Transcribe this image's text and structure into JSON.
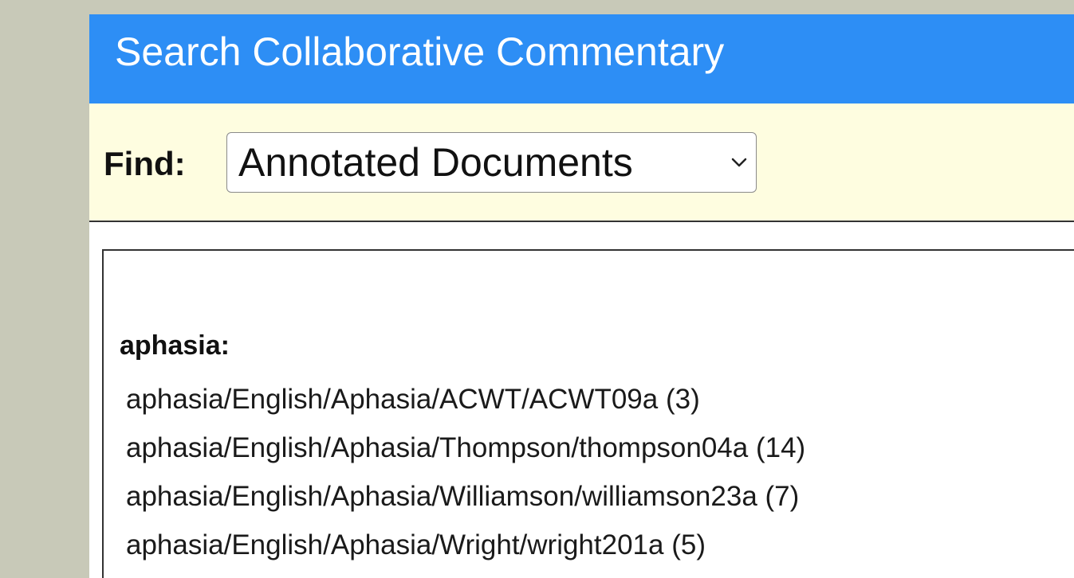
{
  "header": {
    "title": "Search Collaborative Commentary"
  },
  "find": {
    "label": "Find:",
    "selected_option": "Annotated Documents",
    "chevron_icon": "chevron-down-icon"
  },
  "results": {
    "group": "aphasia:",
    "items": [
      "aphasia/English/Aphasia/ACWT/ACWT09a (3)",
      "aphasia/English/Aphasia/Thompson/thompson04a (14)",
      "aphasia/English/Aphasia/Williamson/williamson23a (7)",
      "aphasia/English/Aphasia/Wright/wright201a (5)"
    ]
  },
  "colors": {
    "header_bg": "#2d8ef5",
    "findbar_bg": "#fefde0",
    "page_bg": "#c8c9b8"
  }
}
